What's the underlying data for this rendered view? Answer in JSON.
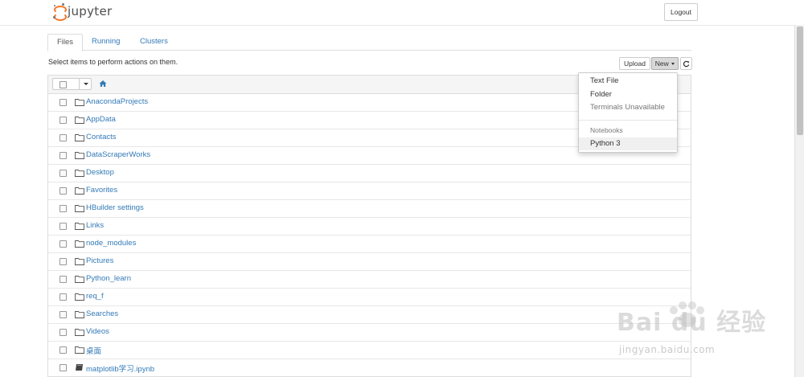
{
  "header": {
    "logo_text": "jupyter",
    "logout_label": "Logout"
  },
  "tabs": [
    {
      "label": "Files",
      "active": true
    },
    {
      "label": "Running",
      "active": false
    },
    {
      "label": "Clusters",
      "active": false
    }
  ],
  "toolbar": {
    "instruction": "Select items to perform actions on them.",
    "upload_label": "Upload",
    "new_label": "New",
    "refresh_icon": "refresh-icon"
  },
  "breadcrumb": {
    "home_icon": "home-icon"
  },
  "files": [
    {
      "name": "AnacondaProjects",
      "type": "folder"
    },
    {
      "name": "AppData",
      "type": "folder"
    },
    {
      "name": "Contacts",
      "type": "folder"
    },
    {
      "name": "DataScraperWorks",
      "type": "folder"
    },
    {
      "name": "Desktop",
      "type": "folder"
    },
    {
      "name": "Favorites",
      "type": "folder"
    },
    {
      "name": "HBuilder settings",
      "type": "folder"
    },
    {
      "name": "Links",
      "type": "folder"
    },
    {
      "name": "node_modules",
      "type": "folder"
    },
    {
      "name": "Pictures",
      "type": "folder"
    },
    {
      "name": "Python_learn",
      "type": "folder"
    },
    {
      "name": "req_f",
      "type": "folder"
    },
    {
      "name": "Searches",
      "type": "folder"
    },
    {
      "name": "Videos",
      "type": "folder"
    },
    {
      "name": "桌面",
      "type": "folder"
    },
    {
      "name": "matplotlib学习.ipynb",
      "type": "notebook"
    }
  ],
  "new_menu": {
    "items": [
      {
        "label": "Text File",
        "state": "enabled"
      },
      {
        "label": "Folder",
        "state": "enabled"
      },
      {
        "label": "Terminals Unavailable",
        "state": "disabled"
      }
    ],
    "section_header": "Notebooks",
    "kernels": [
      {
        "label": "Python 3",
        "state": "hover"
      }
    ]
  },
  "watermark": {
    "text": "Bai du 经验",
    "url": "jingyan.baidu.com"
  },
  "colors": {
    "link": "#337ab7",
    "brand_orange": "#f37726"
  }
}
